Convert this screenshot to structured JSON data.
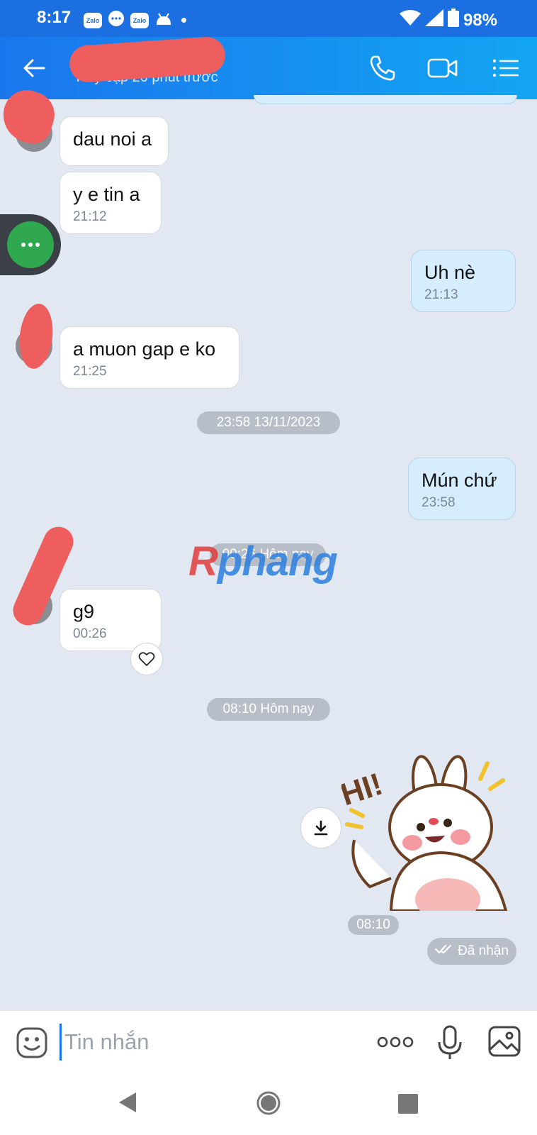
{
  "status_bar": {
    "time": "8:17",
    "app_icons": [
      "Zalo",
      "messenger-icon",
      "Zalo",
      "android-icon"
    ],
    "battery": "98%"
  },
  "header": {
    "contact_name": "",
    "last_seen": "Truy cập 20 phút trước",
    "icons": [
      "back-arrow-icon",
      "phone-icon",
      "video-icon",
      "list-menu-icon"
    ]
  },
  "messages": [
    {
      "direction": "in",
      "text": "dau noi a",
      "time": ""
    },
    {
      "direction": "in",
      "text": "y e tin a",
      "time": "21:12"
    },
    {
      "direction": "out",
      "text": "Uh nè",
      "time": "21:13"
    },
    {
      "direction": "in",
      "text": "a muon gap e ko",
      "time": "21:25"
    },
    {
      "direction": "out",
      "text": "Mún chứ",
      "time": "23:58"
    },
    {
      "direction": "in",
      "text": "g9",
      "time": "00:26"
    }
  ],
  "dividers": {
    "d1": "23:58 13/11/2023",
    "d2": "00:26 Hôm nay",
    "d3": "08:10 Hôm nay"
  },
  "watermark": {
    "part1": "R",
    "part2": "phang"
  },
  "sticker": {
    "text": "HI!",
    "time": "08:10",
    "status": "Đã nhận"
  },
  "composer": {
    "placeholder": "Tin nhắn"
  },
  "colors": {
    "accent": "#1a76ec",
    "header_gradient_end": "#13a5f3",
    "chat_bg": "#e2e8f1",
    "outgoing_bubble": "#d6edfd",
    "float_button": "#2fa84f",
    "redaction": "#ef5e5e"
  }
}
